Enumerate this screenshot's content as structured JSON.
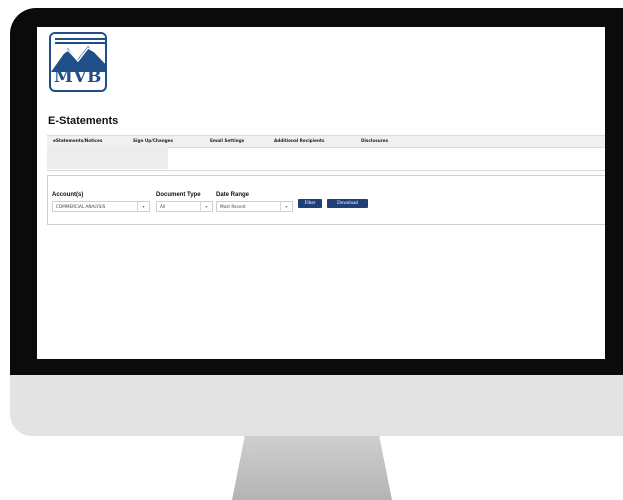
{
  "logo": {
    "text": "MVB"
  },
  "page": {
    "title": "E-Statements"
  },
  "tabs": [
    {
      "label": "eStatements/Notices"
    },
    {
      "label": "Sign Up/Changes"
    },
    {
      "label": "Email Settings"
    },
    {
      "label": "Additional Recipients"
    },
    {
      "label": "Disclosures"
    }
  ],
  "filters": {
    "account": {
      "label": "Account(s)",
      "value": "COMMERCIAL ANALYSIS"
    },
    "doc_type": {
      "label": "Document Type",
      "value": "All"
    },
    "date_range": {
      "label": "Date Range",
      "value": "Most Recent"
    },
    "filter_label": "Filter",
    "download_label": "Download",
    "dropdown_arrow": "▾"
  },
  "colors": {
    "brand": "#1f4e89",
    "button": "#1f3f77",
    "bezel": "#0b0b0b",
    "chin": "#e3e3e3"
  }
}
